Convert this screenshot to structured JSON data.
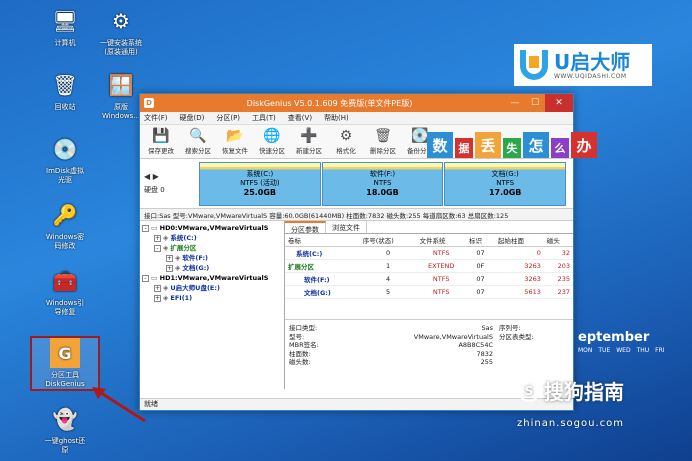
{
  "desktop_icons": [
    {
      "label": "计算机",
      "icon": "computer-icon"
    },
    {
      "label": "一键安装系统\n(原装通用)",
      "icon": "install-system-icon"
    },
    {
      "label": "回收站",
      "icon": "recycle-bin-icon"
    },
    {
      "label": "原版\nWindows...",
      "icon": "windows-installer-icon"
    },
    {
      "label": "ImDisk虚拟\n光驱",
      "icon": "imdisk-icon"
    },
    {
      "label": "Windows密\n码修改",
      "icon": "key-icon"
    },
    {
      "label": "Windows引\n导修复",
      "icon": "repair-icon"
    },
    {
      "label": "分区工具\nDiskGenius",
      "icon": "diskgenius-icon"
    },
    {
      "label": "一键ghost还\n原",
      "icon": "ghost-icon"
    }
  ],
  "logo": {
    "main": "U启大师",
    "url": "WWW.UQIDASHI.COM"
  },
  "window": {
    "title": "DiskGenius V5.0.1.609 免费版(单文件PE版)",
    "menu": [
      "文件(F)",
      "硬盘(D)",
      "分区(P)",
      "工具(T)",
      "查看(V)",
      "帮助(H)"
    ],
    "toolbar": [
      "保存更改",
      "搜索分区",
      "恢复文件",
      "快速分区",
      "新建分区",
      "格式化",
      "删除分区",
      "备份分区"
    ],
    "banner_chars": [
      "数",
      "据",
      "丢",
      "失",
      "怎",
      "么",
      "办"
    ],
    "disk_label": "硬盘 0",
    "partitions": [
      {
        "name": "系统(C:)",
        "fs": "NTFS (活动)",
        "size": "25.0GB"
      },
      {
        "name": "软件(F:)",
        "fs": "NTFS",
        "size": "18.0GB"
      },
      {
        "name": "文档(G:)",
        "fs": "NTFS",
        "size": "17.0GB"
      }
    ],
    "info": "接口:Sas  型号:VMware,VMwareVirtualS  容量:60.0GB(61440MB)  柱面数:7832  磁头数:255  每道扇区数:63  总扇区数:125",
    "tree": [
      {
        "text": "HD0:VMware,VMwareVirtualS",
        "cls": "lbl-hd",
        "indent": 0,
        "pm": "-"
      },
      {
        "text": "系统(C:)",
        "cls": "lbl-blue",
        "indent": 1,
        "pm": "+"
      },
      {
        "text": "扩展分区",
        "cls": "lbl-green",
        "indent": 1,
        "pm": "-"
      },
      {
        "text": "软件(F:)",
        "cls": "lbl-blue",
        "indent": 2,
        "pm": "+"
      },
      {
        "text": "文档(G:)",
        "cls": "lbl-blue",
        "indent": 2,
        "pm": "+"
      },
      {
        "text": "HD1:VMware,VMwareVirtualS",
        "cls": "lbl-hd",
        "indent": 0,
        "pm": "-"
      },
      {
        "text": "U启大师U盘(E:)",
        "cls": "lbl-blue",
        "indent": 1,
        "pm": "+"
      },
      {
        "text": "EFI(1)",
        "cls": "lbl-blue",
        "indent": 1,
        "pm": "+"
      }
    ],
    "tabs": [
      "分区参数",
      "浏览文件"
    ],
    "table_headers": [
      "卷标",
      "序号(状态)",
      "文件系统",
      "标识",
      "起始柱面",
      "磁头"
    ],
    "table_rows": [
      {
        "label": "系统(C:)",
        "seq": "0",
        "fs": "NTFS",
        "id": "07",
        "cyl": "0",
        "head": "32",
        "indent": 1
      },
      {
        "label": "扩展分区",
        "seq": "1",
        "fs": "EXTEND",
        "id": "0F",
        "cyl": "3263",
        "head": "203",
        "indent": 0
      },
      {
        "label": "软件(F:)",
        "seq": "4",
        "fs": "NTFS",
        "id": "07",
        "cyl": "3263",
        "head": "235",
        "indent": 2
      },
      {
        "label": "文档(G:)",
        "seq": "5",
        "fs": "NTFS",
        "id": "07",
        "cyl": "5613",
        "head": "237",
        "indent": 2
      }
    ],
    "details": [
      {
        "k": "接口类型:",
        "v": "Sas",
        "k2": "序列号:"
      },
      {
        "k": "型号:",
        "v": "VMware,VMwareVirtualS",
        "k2": "分区表类型:"
      },
      {
        "k": "MBR签名:",
        "v": "A8B8C54C",
        "k2": ""
      },
      {
        "k": "",
        "v": "",
        "k2": ""
      },
      {
        "k": "柱面数:",
        "v": "7832",
        "k2": ""
      },
      {
        "k": "磁头数:",
        "v": "255",
        "k2": ""
      }
    ],
    "status": "就绪"
  },
  "calendar": {
    "month": "eptember",
    "days": [
      "MON",
      "TUE",
      "WED",
      "THU",
      "FRI"
    ]
  },
  "watermark": {
    "text": "搜狗指南",
    "url": "zhinan.sogou.com"
  }
}
